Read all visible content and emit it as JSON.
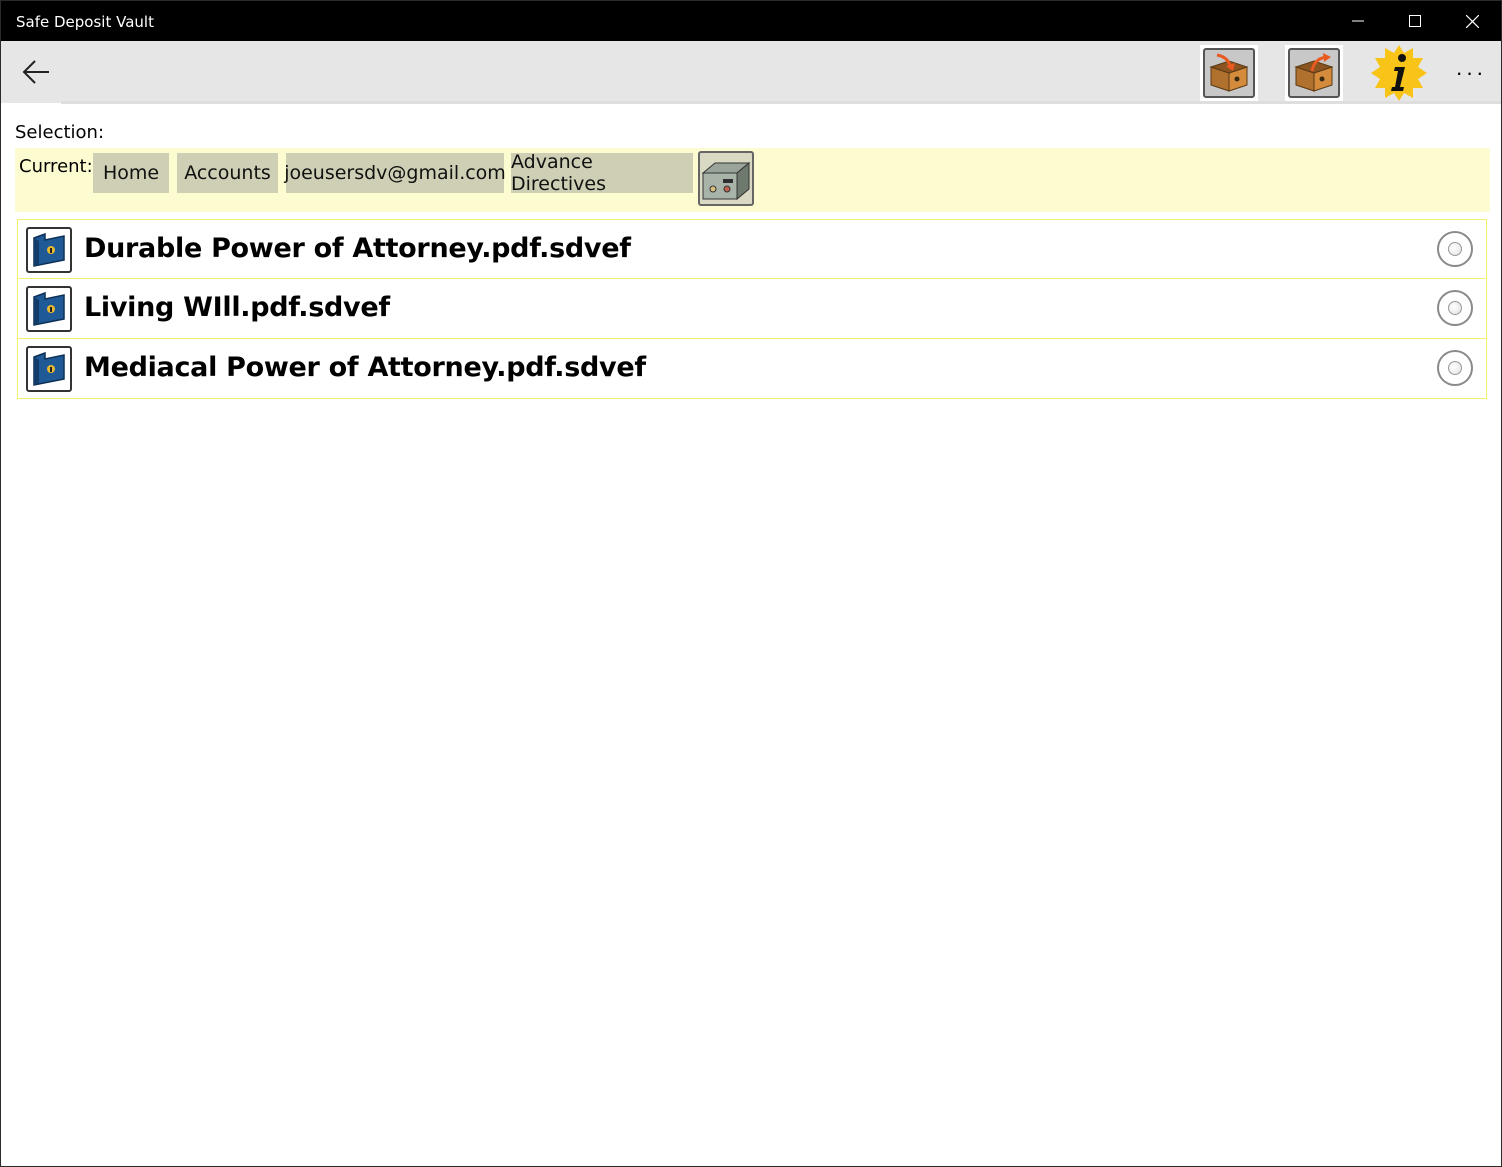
{
  "window": {
    "title": "Safe Deposit Vault",
    "controls": [
      "minimize-icon",
      "maximize-icon",
      "close-icon"
    ]
  },
  "appbar": {
    "back_icon": "back-arrow-icon",
    "buttons": [
      {
        "name": "import-box",
        "icon": "box-import-icon"
      },
      {
        "name": "export-box",
        "icon": "box-export-icon"
      },
      {
        "name": "info",
        "icon": "info-badge-icon"
      }
    ],
    "more_label": "···"
  },
  "selection": {
    "label": "Selection:"
  },
  "breadcrumb": {
    "current_label": "Current:",
    "items": [
      "Home",
      "Accounts",
      "joeusersdv@gmail.com",
      "Advance Directives"
    ],
    "vault_icon": "vault-drawer-icon"
  },
  "files": [
    {
      "name": "Durable Power of Attorney.pdf.sdvef",
      "icon": "locked-folder-icon",
      "selected": false
    },
    {
      "name": "Living WIll.pdf.sdvef",
      "icon": "locked-folder-icon",
      "selected": false
    },
    {
      "name": "Mediacal Power of Attorney.pdf.sdvef",
      "icon": "locked-folder-icon",
      "selected": false
    }
  ],
  "colors": {
    "titlebar": "#000000",
    "appbar": "#e6e6e6",
    "breadcrumb_bg": "#fcfcd0",
    "crumb_bg": "#cfcfb5",
    "row_border": "#f4ef6c",
    "folder_blue": "#1f5a96",
    "info_gold": "#f7c417"
  }
}
